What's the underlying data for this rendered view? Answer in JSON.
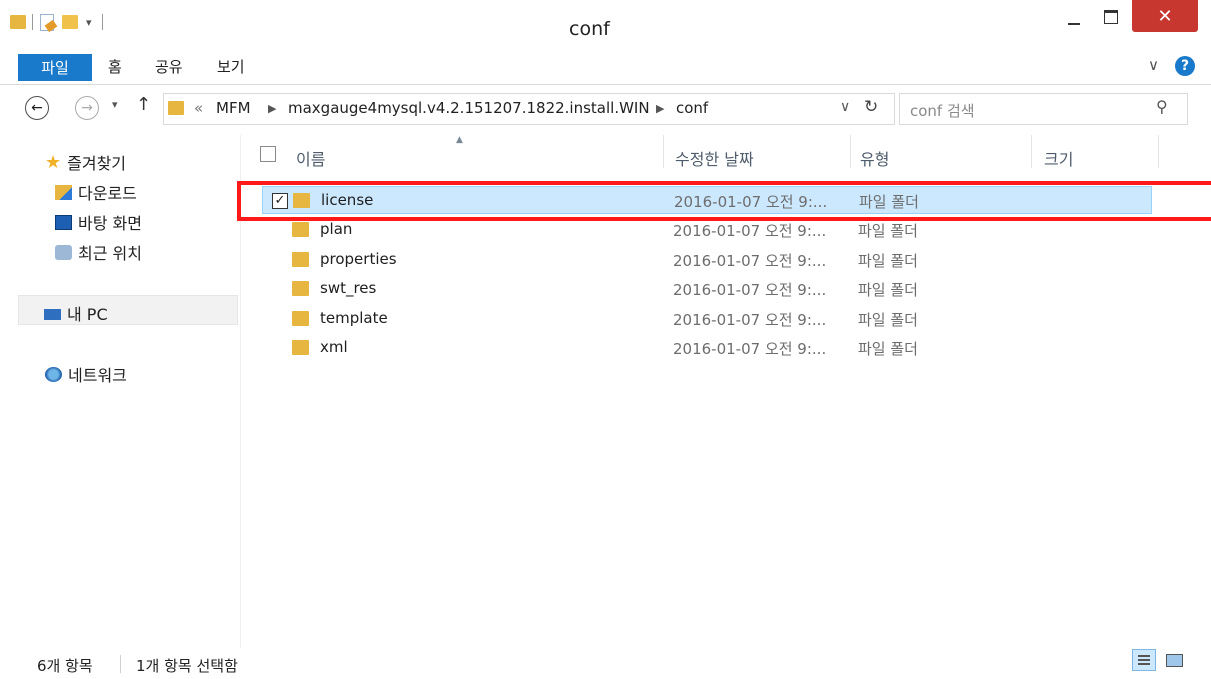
{
  "window": {
    "title": "conf",
    "buttons": {
      "minimize": "minimize",
      "maximize": "maximize",
      "close": "close"
    },
    "close_color": "#c7372f",
    "accent": "#1979ca"
  },
  "ribbon": {
    "tabs": [
      {
        "label": "파일",
        "active": true
      },
      {
        "label": "홈"
      },
      {
        "label": "공유"
      },
      {
        "label": "보기"
      }
    ]
  },
  "address": {
    "back_icon": "back-arrow-icon",
    "forward_icon": "forward-arrow-icon",
    "overflow": "«",
    "path": [
      "MFM",
      "maxgauge4mysql.v4.2.151207.1822.install.WIN",
      "conf"
    ],
    "search_placeholder": "conf 검색"
  },
  "nav": {
    "favorites": {
      "label": "즐겨찾기",
      "items": [
        {
          "label": "다운로드",
          "icon": "downloads-icon"
        },
        {
          "label": "바탕 화면",
          "icon": "desktop-icon"
        },
        {
          "label": "최근 위치",
          "icon": "recent-places-icon"
        }
      ]
    },
    "this_pc": {
      "label": "내 PC",
      "icon": "computer-icon"
    },
    "network": {
      "label": "네트워크",
      "icon": "network-icon"
    }
  },
  "list": {
    "columns": [
      "이름",
      "수정한 날짜",
      "유형",
      "크기"
    ],
    "rows": [
      {
        "name": "license",
        "modified": "2016-01-07 오전 9:...",
        "type": "파일 폴더",
        "selected": true,
        "checked": true
      },
      {
        "name": "plan",
        "modified": "2016-01-07 오전 9:...",
        "type": "파일 폴더"
      },
      {
        "name": "properties",
        "modified": "2016-01-07 오전 9:...",
        "type": "파일 폴더"
      },
      {
        "name": "swt_res",
        "modified": "2016-01-07 오전 9:...",
        "type": "파일 폴더"
      },
      {
        "name": "template",
        "modified": "2016-01-07 오전 9:...",
        "type": "파일 폴더"
      },
      {
        "name": "xml",
        "modified": "2016-01-07 오전 9:...",
        "type": "파일 폴더"
      }
    ]
  },
  "status": {
    "item_count": "6개 항목",
    "selection": "1개 항목 선택함"
  },
  "annotation": {
    "color": "#ff1a1a"
  }
}
